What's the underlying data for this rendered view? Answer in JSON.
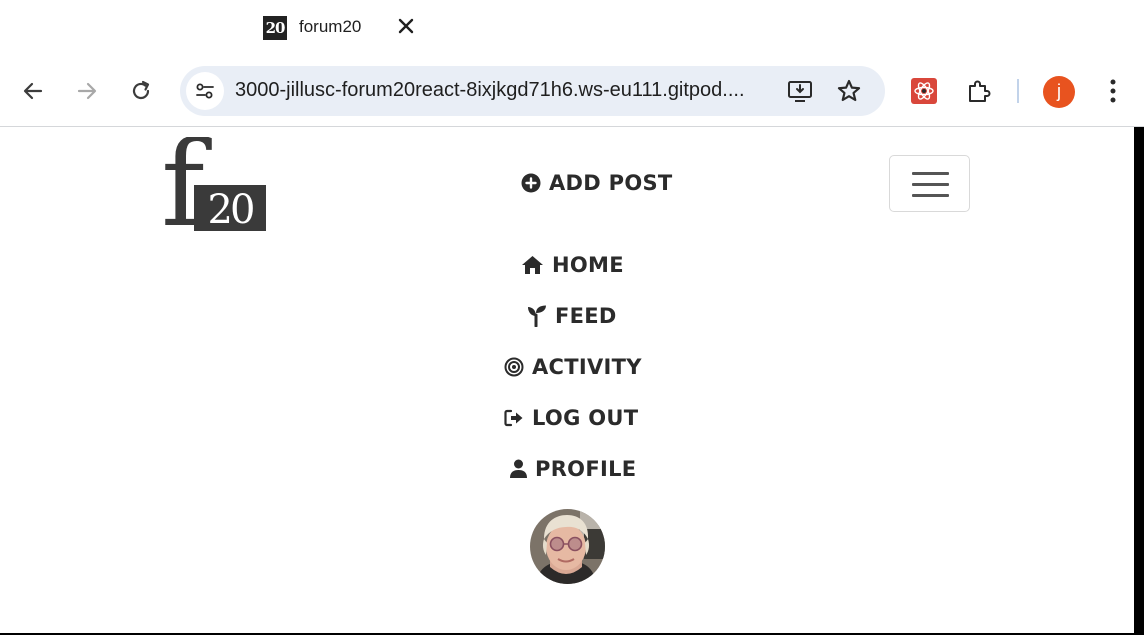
{
  "browser": {
    "tab": {
      "title": "forum20",
      "favicon_text": "20"
    },
    "address_bar": {
      "url": "3000-jillusc-forum20react-8ixjkgd71h6.ws-eu111.gitpod...."
    },
    "profile_initial": "j",
    "colors": {
      "omnibox": "#e9eef6",
      "profile": "#e8531f",
      "extension": "#d9473b"
    }
  },
  "site": {
    "logo": {
      "letter": "f",
      "number": "20"
    },
    "nav": {
      "add_post": "ADD POST",
      "home": "HOME",
      "feed": "FEED",
      "activity": "ACTIVITY",
      "log_out": "LOG OUT",
      "profile": "PROFILE"
    },
    "icons": {
      "add_post": "plus-circle-icon",
      "home": "house-icon",
      "feed": "seedling-icon",
      "activity": "bullseye-icon",
      "log_out": "sign-out-icon",
      "profile": "user-icon"
    }
  }
}
